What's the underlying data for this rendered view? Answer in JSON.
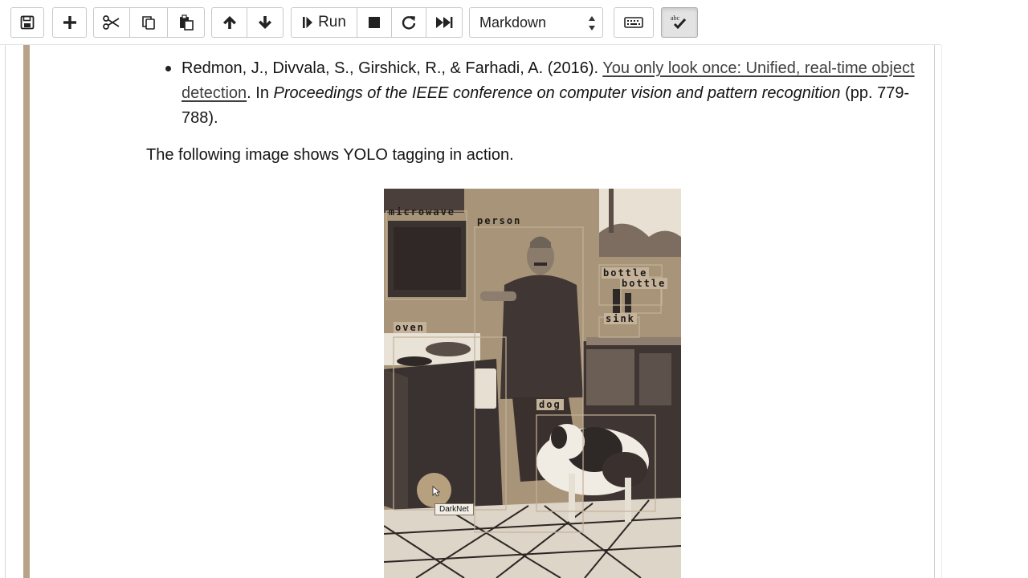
{
  "toolbar": {
    "buttons": [
      {
        "name": "save-button",
        "icon": "floppy-disk-icon"
      },
      {
        "name": "insert-cell-button",
        "icon": "plus-icon"
      },
      {
        "name": "cut-button",
        "icon": "scissors-icon"
      },
      {
        "name": "copy-button",
        "icon": "copy-icon"
      },
      {
        "name": "paste-button",
        "icon": "paste-icon"
      },
      {
        "name": "move-up-button",
        "icon": "arrow-up-icon"
      },
      {
        "name": "move-down-button",
        "icon": "arrow-down-icon"
      },
      {
        "name": "run-button",
        "icon": "step-forward-icon"
      },
      {
        "name": "interrupt-button",
        "icon": "stop-icon"
      },
      {
        "name": "restart-button",
        "icon": "redo-icon"
      },
      {
        "name": "restart-run-all-button",
        "icon": "fast-forward-icon"
      },
      {
        "name": "command-palette-button",
        "icon": "keyboard-icon"
      },
      {
        "name": "spellcheck-button",
        "icon": "spellcheck-icon"
      }
    ],
    "run_label": "Run",
    "cell_type": "Markdown"
  },
  "cell": {
    "reference": {
      "authors": "Redmon, J., Divvala, S., Girshick, R., & Farhadi, A. (2016).",
      "link_text": "You only look once: Unified, real-time object detection",
      "after_link": ". In ",
      "venue": "Proceedings of the IEEE conference on computer vision and pattern recognition",
      "pages": " (pp. 779-788)."
    },
    "paragraph": "The following image shows YOLO tagging in action.",
    "image": {
      "detections": [
        "microwave",
        "person",
        "bottle",
        "bottle",
        "oven",
        "sink",
        "dog"
      ],
      "tooltip": "DarkNet"
    }
  },
  "colors": {
    "cell_bar": "#b7a488",
    "image_tint": "#b5a38a",
    "image_dark": "#3b3330"
  }
}
